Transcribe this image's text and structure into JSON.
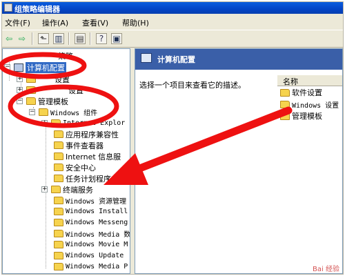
{
  "window": {
    "title": "组策略编辑器"
  },
  "menu": [
    {
      "label": "文件(F)"
    },
    {
      "label": "操作(A)"
    },
    {
      "label": "查看(V)"
    },
    {
      "label": "帮助(H)"
    }
  ],
  "toolbar": {
    "icons": [
      "back-icon",
      "forward-icon",
      "up-icon",
      "show-hide-tree-icon",
      "export-icon",
      "help-icon",
      "properties-icon"
    ]
  },
  "tree": {
    "root_label": "策略",
    "computer_config": "计算机配置",
    "software_settings": "设置",
    "windows_settings": "设置",
    "admin_templates": "管理模板",
    "windows_components": "Windows 组件",
    "items": [
      "Internet Explor",
      "应用程序兼容性",
      "事件查看器",
      "Internet 信息服",
      "安全中心",
      "任务计划程序",
      "终端服务",
      "Windows 资源管理",
      "Windows Install",
      "Windows Messeng",
      "Windows Media 数",
      "Windows Movie M",
      "Windows Update",
      "Windows Media P"
    ]
  },
  "right_pane": {
    "header_title": "计算机配置",
    "description": "选择一个项目来查看它的描述。",
    "list_header": "名称",
    "list_items": [
      "软件设置",
      "Windows 设置",
      "管理模板"
    ]
  },
  "annotations": {
    "color": "#ee1111"
  },
  "watermark": "Bai 经验"
}
